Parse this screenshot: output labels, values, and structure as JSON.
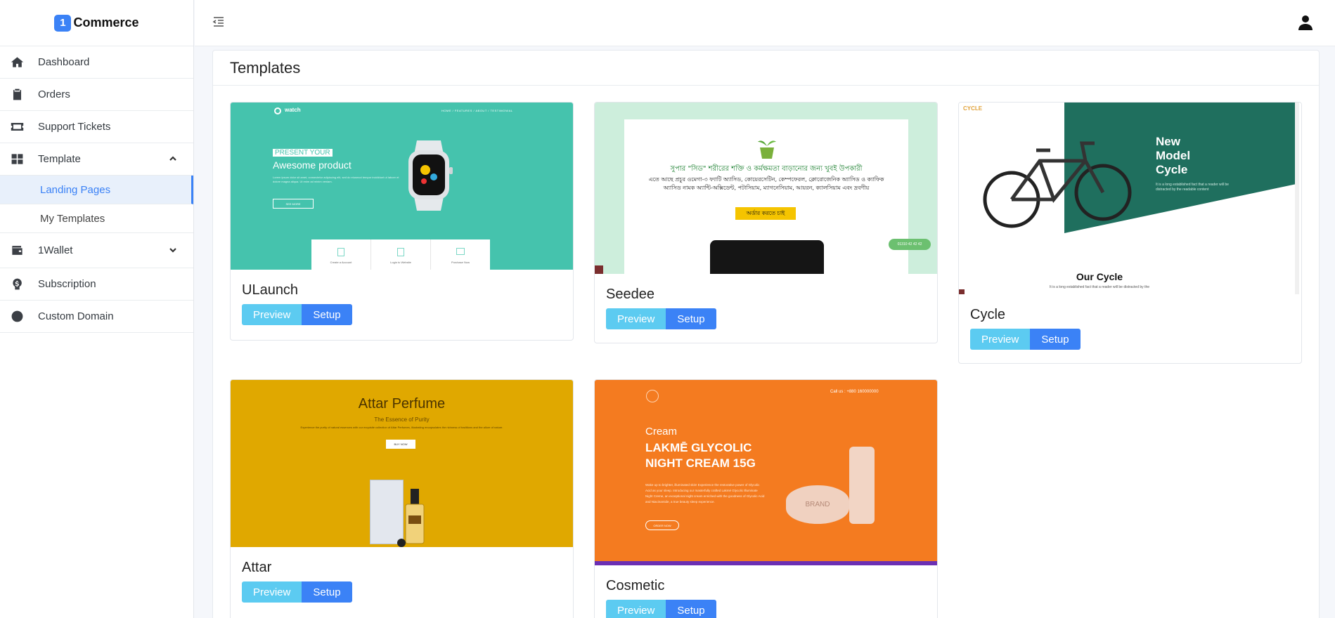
{
  "brand": {
    "badge": "1",
    "name": "Commerce"
  },
  "sidebar": {
    "items": [
      {
        "label": "Dashboard",
        "icon": "home-icon"
      },
      {
        "label": "Orders",
        "icon": "clipboard-icon"
      },
      {
        "label": "Support Tickets",
        "icon": "ticket-icon"
      },
      {
        "label": "Template",
        "icon": "grid-icon",
        "expanded": true
      },
      {
        "label": "1Wallet",
        "icon": "wallet-icon",
        "expanded": false
      },
      {
        "label": "Subscription",
        "icon": "subscription-icon"
      },
      {
        "label": "Custom Domain",
        "icon": "globe-icon"
      }
    ],
    "template_sub": [
      {
        "label": "Landing Pages",
        "active": true
      },
      {
        "label": "My Templates",
        "active": false
      }
    ]
  },
  "main": {
    "title": "Templates"
  },
  "templates": [
    {
      "name": "ULaunch",
      "preview_label": "Preview",
      "setup_label": "Setup",
      "thumb": {
        "logo": "watch",
        "nav": "HOME  /  FEATURES  /  ABOUT  /  TESTIMONIAL",
        "tag": "PRESENT YOUR",
        "headline": "Awesome product",
        "body": "Lorem ipsum dolor sit amet, consectetur adipiscing elit, sed do eiusmod tempor incididunt ut labore et dolore magna aliqua. Ut enim ad minim veniam.",
        "cta": "SEE MORE",
        "features": [
          "Create a Account",
          "Login to Website",
          "Purchase Now"
        ]
      }
    },
    {
      "name": "Seedee",
      "preview_label": "Preview",
      "setup_label": "Setup",
      "thumb": {
        "headline": "সুপার \"সিড\" শরীরের শক্তি ও কর্মক্ষমতা বাড়ানোর জন্য খুবই উপকারী",
        "body": "এতে আছে প্রচুর ওমেগা-৩ ফ্যাটি অ্যাসিড, কোয়েরসেটিন, কেম্পফেরল, ক্লোরোজেনিক অ্যাসিড ও ক্যাফিক অ্যাসিড নামক অ্যান্টি-অক্সিডেন্ট, পটাসিয়াম, ম্যাগনেসিয়াম, আয়রন, ক্যালসিয়াম এবং দ্রবণীয়",
        "cta": "অর্ডার করতে চাই",
        "phone": "01310 42 42 42"
      }
    },
    {
      "name": "Cycle",
      "preview_label": "Preview",
      "setup_label": "Setup",
      "thumb": {
        "logo": "CYCLE",
        "headline": "New Model Cycle",
        "body": "It is a long established fact that a reader will be distracted by the readable content",
        "subhead": "Our Cycle",
        "subbody": "It is a long established fact that a reader will be distracted by the"
      }
    },
    {
      "name": "Attar",
      "preview_label": "Preview",
      "setup_label": "Setup",
      "thumb": {
        "headline": "Attar Perfume",
        "sub": "The Essence of Purity",
        "body": "Experience the purity of natural essences with our exquisite collection of Attar Perfumes, illustrating encapsulates the richness of traditions and the allure of nature.",
        "cta": "BUY NOW"
      }
    },
    {
      "name": "Cosmetic",
      "preview_label": "Preview",
      "setup_label": "Setup",
      "thumb": {
        "call": "Call us : +880 160000000",
        "kicker": "Cream",
        "headline": "LAKMĒ GLYCOLIC NIGHT CREAM 15G",
        "body": "Wake up to brighter, illuminated skin! Experience the restorative power of Glycolic Acid as your sleep. Introducing our masterfully crafted Lakmé Glycolic Illuminate Night Creme, an exceptional night cream enriched with the goodness of Glycolic Acid and Niacinamide, a true beauty sleep experience.",
        "cta": "ORDER NOW",
        "brand": "BRAND"
      }
    }
  ]
}
